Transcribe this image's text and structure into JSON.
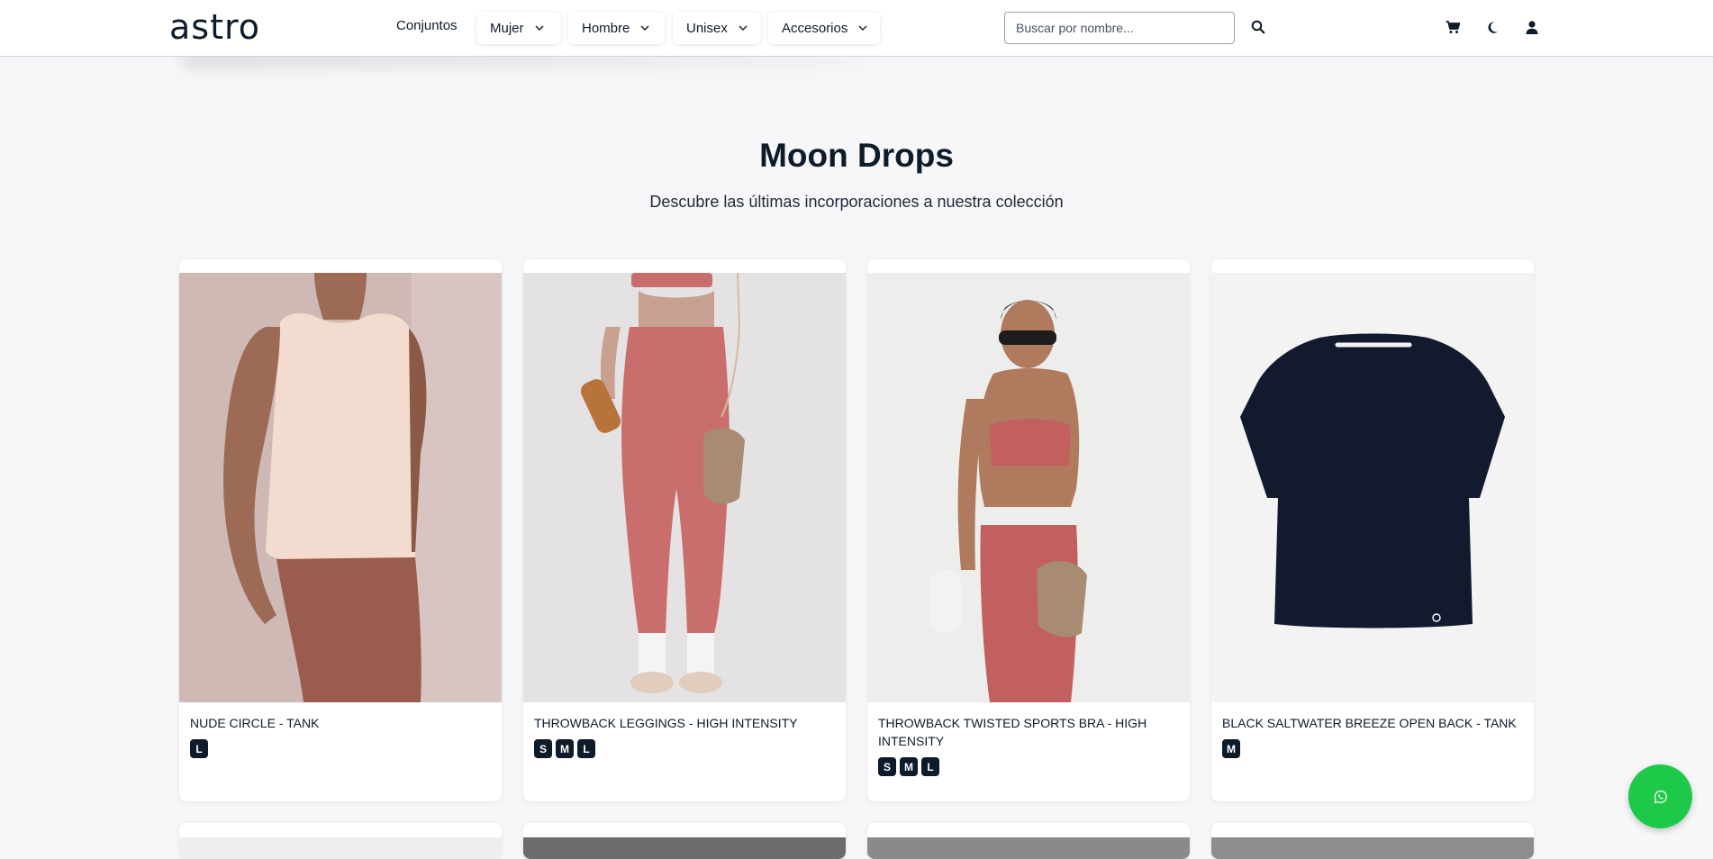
{
  "brand": {
    "logo_text": "astro"
  },
  "nav": {
    "conjuntos": "Conjuntos",
    "mujer": "Mujer",
    "hombre": "Hombre",
    "unisex": "Unisex",
    "accesorios": "Accesorios"
  },
  "search": {
    "placeholder": "Buscar por nombre...",
    "value": ""
  },
  "icons": {
    "chevron": "chevron-down-icon",
    "search": "search-icon",
    "cart": "cart-icon",
    "theme": "moon-icon",
    "user": "user-icon",
    "whatsapp": "whatsapp-icon"
  },
  "hero": {
    "title": "Moon Drops",
    "subtitle": "Descubre las últimas incorporaciones a nuestra colección"
  },
  "products": [
    {
      "name": "NUDE CIRCLE - TANK",
      "sizes": [
        "L"
      ]
    },
    {
      "name": "THROWBACK LEGGINGS - HIGH INTENSITY",
      "sizes": [
        "S",
        "M",
        "L"
      ]
    },
    {
      "name": "THROWBACK TWISTED SPORTS BRA - HIGH INTENSITY",
      "sizes": [
        "S",
        "M",
        "L"
      ]
    },
    {
      "name": "BLACK SALTWATER BREEZE OPEN BACK - TANK",
      "sizes": [
        "M"
      ]
    }
  ],
  "colors": {
    "navy": "#0d1b2a",
    "whatsapp_green": "#1ec94a",
    "background": "#f7f7f9"
  }
}
